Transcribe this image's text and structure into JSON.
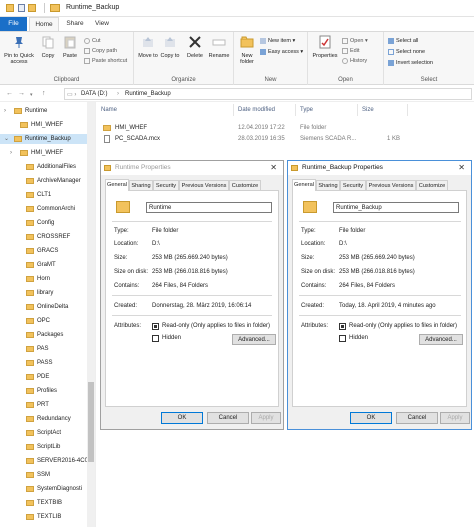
{
  "window": {
    "title": "Runtime_Backup"
  },
  "tabs": {
    "file": "File",
    "home": "Home",
    "share": "Share",
    "view": "View"
  },
  "ribbon": {
    "pin_label": "Pin to Quick access",
    "copy_label": "Copy",
    "paste_label": "Paste",
    "cut_label": "Cut",
    "copy_path_label": "Copy path",
    "paste_shortcut_label": "Paste shortcut",
    "clipboard_group": "Clipboard",
    "move_to_label": "Move to",
    "copy_to_label": "Copy to",
    "delete_label": "Delete",
    "rename_label": "Rename",
    "organize_group": "Organize",
    "new_folder_label": "New folder",
    "new_item_label": "New item",
    "easy_access_label": "Easy access",
    "new_group": "New",
    "properties_label": "Properties",
    "open_label": "Open",
    "edit_label": "Edit",
    "history_label": "History",
    "open_group": "Open",
    "select_all_label": "Select all",
    "select_none_label": "Select none",
    "invert_selection_label": "Invert selection",
    "select_group": "Select"
  },
  "address": {
    "crumbs": [
      "DATA (D:)",
      "Runtime_Backup"
    ]
  },
  "tree": {
    "items": [
      "Runtime",
      "HMI_WHEF",
      "Runtime_Backup",
      "HMI_WHEF",
      "AdditionalFiles",
      "ArchiveManager",
      "CLT1",
      "CommonArchi",
      "Config",
      "CROSSREF",
      "GRACS",
      "GraMT",
      "Horn",
      "library",
      "OnlineDelta",
      "OPC",
      "Packages",
      "PAS",
      "PASS",
      "PDE",
      "Profiles",
      "PRT",
      "Redundancy",
      "ScriptAct",
      "ScriptLib",
      "SERVER2016-4C0",
      "SSM",
      "SystemDiagnosti",
      "TEXTBIB",
      "TEXTLIB"
    ]
  },
  "files": {
    "columns": [
      "Name",
      "Date modified",
      "Type",
      "Size"
    ],
    "rows": [
      {
        "name": "HMI_WHEF",
        "date": "12.04.2019 17:22",
        "type": "File folder",
        "size": ""
      },
      {
        "name": "PC_SCADA.mcx",
        "date": "28.03.2019 16:35",
        "type": "Siemens SCADA R...",
        "size": "1 KB"
      }
    ]
  },
  "dialog_left": {
    "title": "Runtime Properties",
    "tabs": [
      "General",
      "Sharing",
      "Security",
      "Previous Versions",
      "Customize"
    ],
    "name": "Runtime",
    "type_label": "Type:",
    "type": "File folder",
    "location_label": "Location:",
    "location": "D:\\",
    "size_label": "Size:",
    "size": "253 MB (265.669.240 bytes)",
    "size_on_disk_label": "Size on disk:",
    "size_on_disk": "253 MB (266.018.816 bytes)",
    "contains_label": "Contains:",
    "contains": "264 Files, 84 Folders",
    "created_label": "Created:",
    "created": "Donnerstag, 28. März 2019, 16:06:14",
    "attributes_label": "Attributes:",
    "readonly_label": "Read-only (Only applies to files in folder)",
    "hidden_label": "Hidden",
    "advanced_label": "Advanced...",
    "ok": "OK",
    "cancel": "Cancel",
    "apply": "Apply"
  },
  "dialog_right": {
    "title": "Runtime_Backup Properties",
    "tabs": [
      "General",
      "Sharing",
      "Security",
      "Previous Versions",
      "Customize"
    ],
    "name": "Runtime_Backup",
    "type_label": "Type:",
    "type": "File folder",
    "location_label": "Location:",
    "location": "D:\\",
    "size_label": "Size:",
    "size": "253 MB (265.669.240 bytes)",
    "size_on_disk_label": "Size on disk:",
    "size_on_disk": "253 MB (266.018.816 bytes)",
    "contains_label": "Contains:",
    "contains": "264 Files, 84 Folders",
    "created_label": "Created:",
    "created": "Today, 18. April 2019, 4 minutes ago",
    "attributes_label": "Attributes:",
    "readonly_label": "Read-only (Only applies to files in folder)",
    "hidden_label": "Hidden",
    "advanced_label": "Advanced...",
    "ok": "OK",
    "cancel": "Cancel",
    "apply": "Apply"
  }
}
